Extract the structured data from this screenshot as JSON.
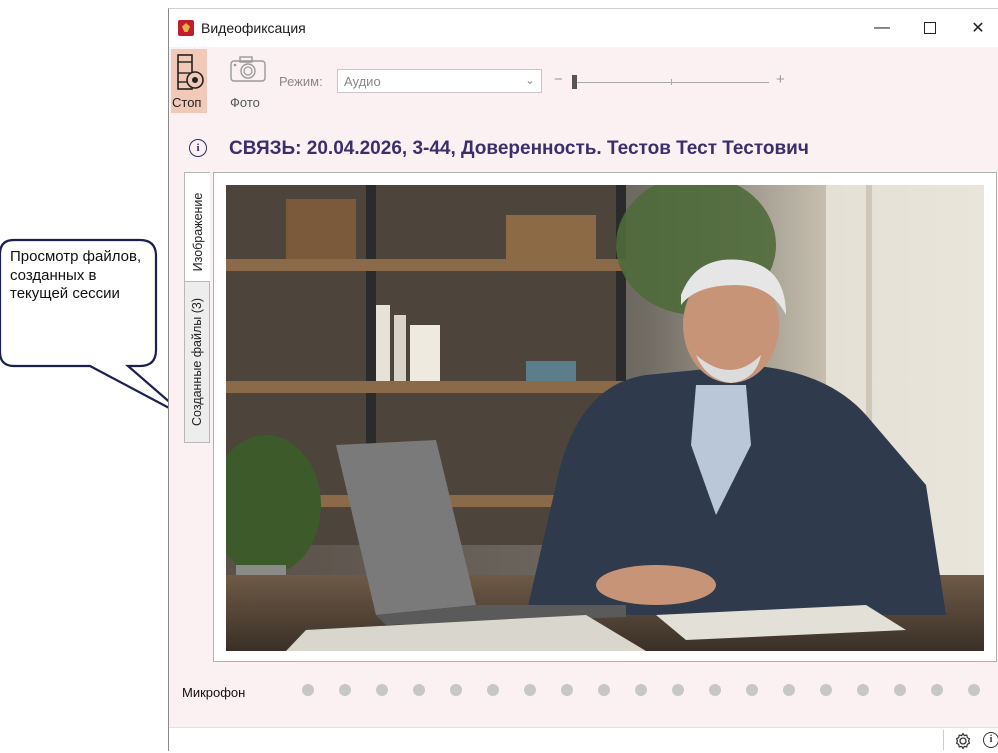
{
  "callout": {
    "text": "Просмотр файлов, созданных в текущей сессии"
  },
  "window": {
    "title": "Видеофиксация",
    "minimize": "—",
    "close": "✕"
  },
  "toolbar": {
    "stop_label": "Стоп",
    "photo_label": "Фото",
    "mode_label": "Режим:",
    "mode_value": "Аудио",
    "slider_minus": "−",
    "slider_plus": "+"
  },
  "header": {
    "title": "СВЯЗЬ: 20.04.2026, 3-44, Доверенность. Тестов Тест Тестович"
  },
  "tabs": [
    {
      "label": "Изображение",
      "active": true
    },
    {
      "label": "Созданные файлы (3)",
      "active": false
    }
  ],
  "microphone": {
    "label": "Микрофон",
    "level_dots": 19,
    "active_dots": 0
  },
  "colors": {
    "accent": "#f2c9b9",
    "title": "#3b2f6a",
    "background": "#fbf1f3"
  }
}
